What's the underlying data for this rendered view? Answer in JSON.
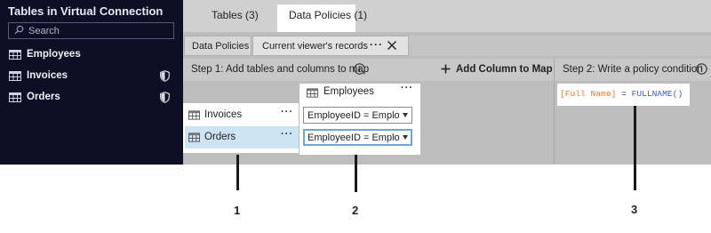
{
  "sidebar": {
    "title": "Tables in Virtual Connection",
    "search_placeholder": "Search",
    "items": [
      {
        "label": "Employees",
        "icon": "table-icon",
        "has_policy": false
      },
      {
        "label": "Invoices",
        "icon": "table-icon",
        "has_policy": true
      },
      {
        "label": "Orders",
        "icon": "table-icon",
        "has_policy": true
      }
    ]
  },
  "tabs": [
    {
      "label": "Tables (3)",
      "active": false
    },
    {
      "label": "Data Policies (1)",
      "active": true
    }
  ],
  "subtabs": {
    "data_policies": "Data Policies",
    "current": "Current viewer's records",
    "more": "···"
  },
  "step1": {
    "label": "Step 1: Add tables and columns to map",
    "add_column": "Add Column to Map"
  },
  "step2": {
    "label": "Step 2: Write a policy condition"
  },
  "tables": [
    {
      "label": "Invoices",
      "selected": false
    },
    {
      "label": "Orders",
      "selected": true
    }
  ],
  "mapping": {
    "table": "Employees",
    "rows": [
      {
        "value": "EmployeeID = Employ"
      },
      {
        "value": "EmployeeID = Employ"
      }
    ]
  },
  "policy": {
    "field": "[Full Name]",
    "operator": " = ",
    "function": "FULLNAME()"
  },
  "callouts": [
    "1",
    "2",
    "3"
  ],
  "colors": {
    "sidebar_bg": "#0e0e26",
    "field_orange": "#e07b39",
    "function_blue": "#3b5bbd",
    "selected_row": "#cde4f5"
  }
}
